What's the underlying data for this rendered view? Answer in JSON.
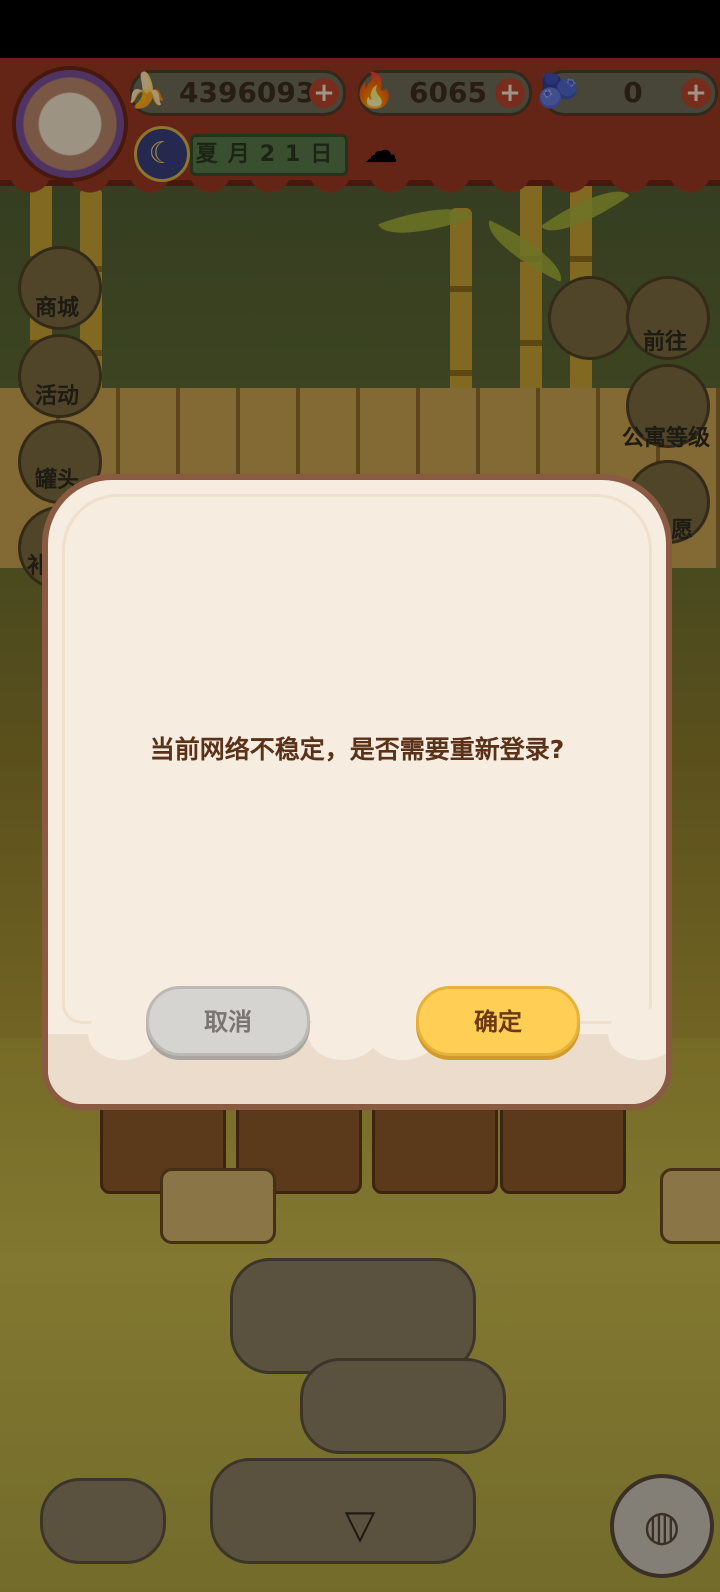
{
  "currencies": [
    {
      "icon": "banana-icon",
      "value": "4396093"
    },
    {
      "icon": "flame-icon",
      "value": "6065"
    },
    {
      "icon": "blue-banana-icon",
      "value": "0"
    }
  ],
  "date": {
    "text": "夏月21日"
  },
  "side_left": [
    {
      "label": "商城",
      "icon": "shop-icon"
    },
    {
      "label": "活动",
      "icon": "gift-icon"
    },
    {
      "label": "罐头",
      "icon": "can-icon"
    },
    {
      "label": "补",
      "icon": "cat-paw-icon"
    }
  ],
  "side_right": [
    {
      "label": "前往",
      "icon": "map-pin-icon"
    },
    {
      "label": "公寓等级",
      "icon": "apartment-level-icon"
    },
    {
      "label": "愿",
      "icon": "heart-wish-icon"
    }
  ],
  "dialog": {
    "message": "当前网络不稳定，是否需要重新登录?",
    "cancel_label": "取消",
    "confirm_label": "确定"
  }
}
